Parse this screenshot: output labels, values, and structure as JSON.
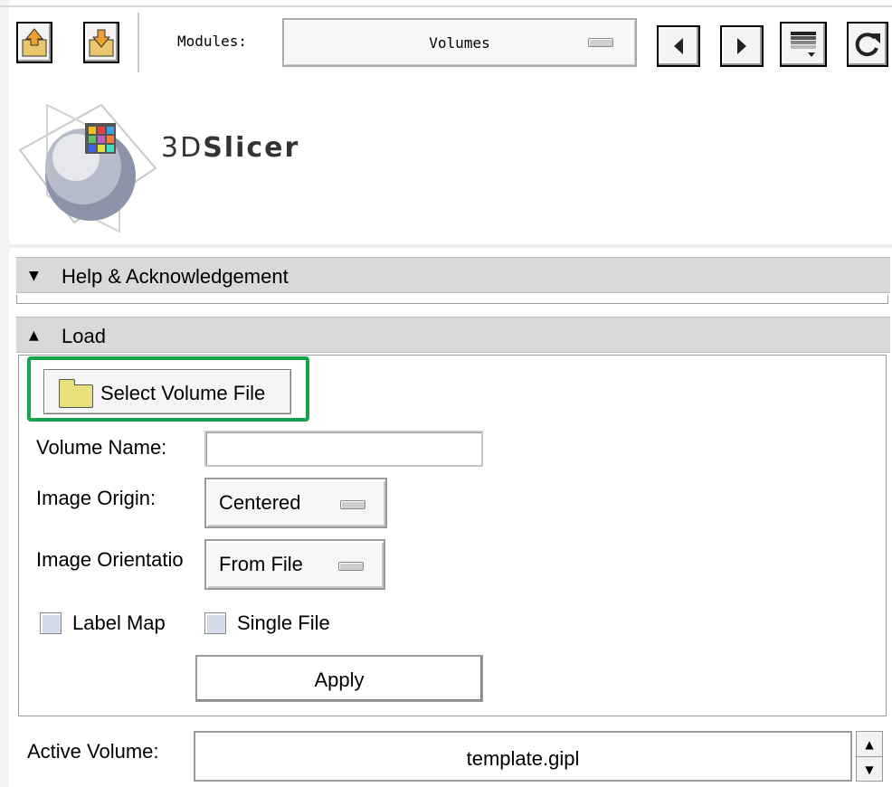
{
  "toolbar": {
    "modules_label": "Modules:",
    "modules_selected": "Volumes",
    "buttons": [
      "load-scene-icon",
      "import-scene-icon",
      "prev-module-icon",
      "next-module-icon",
      "module-history-icon",
      "refresh-icon"
    ]
  },
  "logo": {
    "text_a": "3D",
    "text_b": "Slicer"
  },
  "sections": {
    "help": "Help & Acknowledgement",
    "load": "Load"
  },
  "load": {
    "select_file_button": "Select Volume File",
    "volume_name_label": "Volume Name:",
    "volume_name_value": "",
    "image_origin_label": "Image Origin:",
    "image_origin_value": "Centered",
    "image_orientation_label": "Image Orientatio",
    "image_orientation_value": "From File",
    "label_map": "Label Map",
    "single_file": "Single File",
    "apply": "Apply"
  },
  "active_volume": {
    "label": "Active Volume:",
    "value": "template.gipl"
  },
  "colors": {
    "highlight": "#16a34a",
    "section_header": "#d9d9d9",
    "checkbox": "#d4dcec",
    "folder": "#e8e07a"
  }
}
